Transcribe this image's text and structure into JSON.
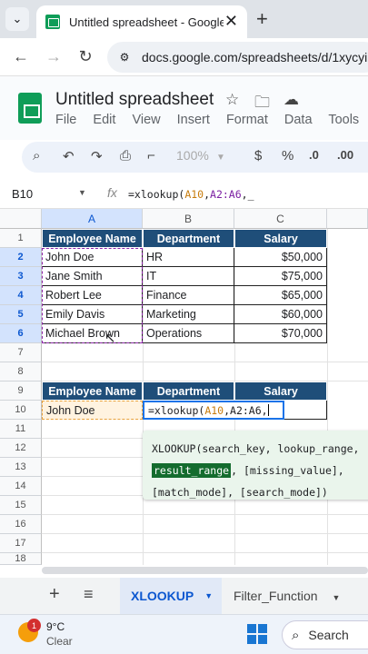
{
  "browser": {
    "tab_title": "Untitled spreadsheet - Google Sheets",
    "url": "docs.google.com/spreadsheets/d/1xycyi"
  },
  "doc": {
    "title": "Untitled spreadsheet",
    "menu": [
      "File",
      "Edit",
      "View",
      "Insert",
      "Format",
      "Data",
      "Tools",
      "E"
    ]
  },
  "toolbar": {
    "zoom": "100%",
    "currency": "$",
    "percent": "%",
    "dec_decrease": ".0",
    "dec_increase": ".00"
  },
  "formula_bar": {
    "cell_ref": "B10",
    "fx": "fx",
    "formula_prefix": "=xlookup(",
    "formula_ref1": "A10",
    "formula_comma1": ",",
    "formula_ref2": "A2:A6",
    "formula_tail": ",_"
  },
  "grid": {
    "columns": [
      "A",
      "B",
      "C"
    ],
    "rows": [
      "1",
      "2",
      "3",
      "4",
      "5",
      "6",
      "7",
      "8",
      "9",
      "10",
      "11",
      "12",
      "13",
      "14",
      "15",
      "16",
      "17",
      "18"
    ],
    "headers": [
      "Employee Name",
      "Department",
      "Salary"
    ],
    "data": [
      [
        "John Doe",
        "HR",
        "$50,000"
      ],
      [
        "Jane Smith",
        "IT",
        "$75,000"
      ],
      [
        "Robert Lee",
        "Finance",
        "$65,000"
      ],
      [
        "Emily Davis",
        "Marketing",
        "$60,000"
      ],
      [
        "Michael Brown",
        "Operations",
        "$70,000"
      ]
    ],
    "lookup_headers": [
      "Employee Name",
      "Department",
      "Salary"
    ],
    "lookup_value": "John Doe",
    "edit_prefix": "=xlookup(",
    "edit_ref1": "A10",
    "edit_ref2": ",A2:A6,"
  },
  "popup": {
    "line1": "XLOOKUP(search_key, lookup_range,",
    "highlighted": "result_range",
    "line2_rest": ", [missing_value],",
    "line3": "[match_mode], [search_mode])"
  },
  "sheets": {
    "active": "XLOOKUP",
    "other": "Filter_Function"
  },
  "taskbar": {
    "badge": "1",
    "temp": "9°C",
    "condition": "Clear",
    "search": "Search"
  }
}
